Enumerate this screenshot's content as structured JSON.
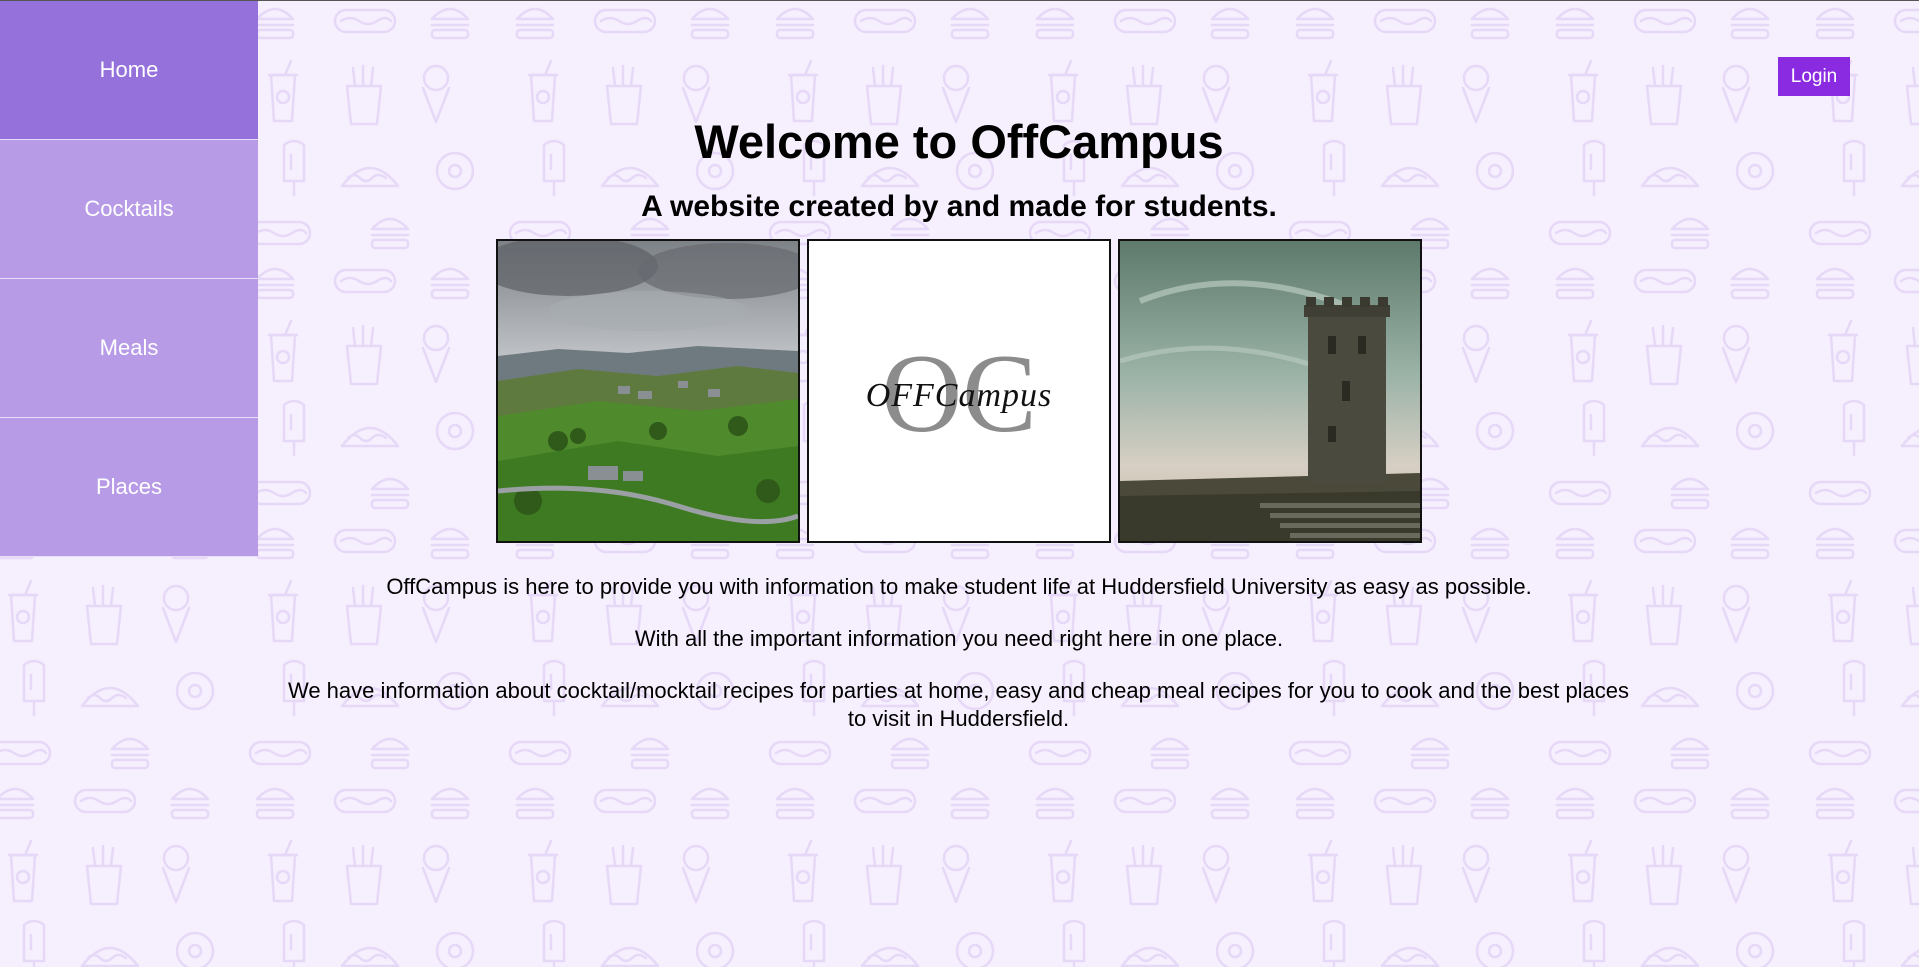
{
  "nav": {
    "items": [
      {
        "label": "Home",
        "active": true
      },
      {
        "label": "Cocktails",
        "active": false
      },
      {
        "label": "Meals",
        "active": false
      },
      {
        "label": "Places",
        "active": false
      }
    ]
  },
  "header": {
    "login_label": "Login"
  },
  "main": {
    "title": "Welcome to OffCampus",
    "subtitle": "A website created by and made for students.",
    "paragraphs": [
      "OffCampus is here to provide you with information to make student life at Huddersfield University as easy as possible.",
      "With all the important information you need right here in one place.",
      "We have information about cocktail/mocktail recipes for parties at home, easy and cheap meal recipes for you to cook and the best places to visit in Huddersfield."
    ],
    "logo": {
      "monogram": "OC",
      "script": "OFFCampus"
    }
  },
  "colors": {
    "background": "#f6effd",
    "sidebar": "#b89be6",
    "sidebar_active": "#9571dc",
    "login_button": "#8a2be2"
  },
  "icons": [
    "burger-icon",
    "hotdog-icon",
    "drink-cup-icon",
    "fries-icon",
    "ice-cream-icon",
    "popsicle-icon",
    "taco-icon",
    "donut-icon"
  ]
}
